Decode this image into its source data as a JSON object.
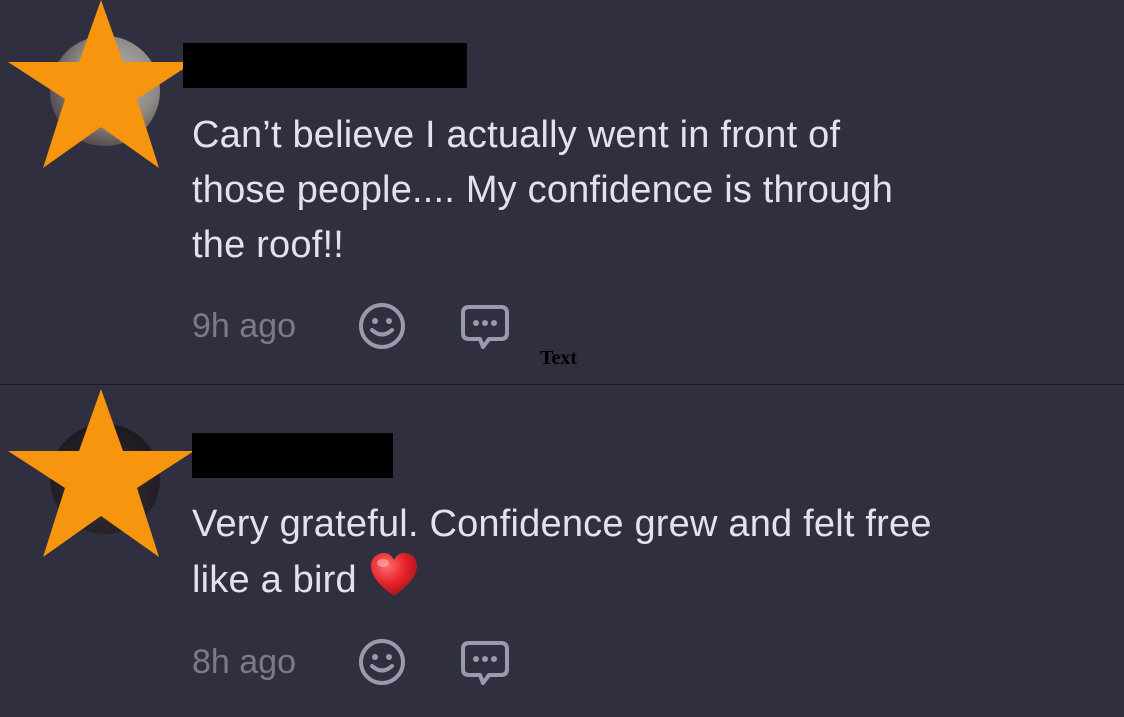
{
  "comments": [
    {
      "author_redacted": true,
      "text": "Can’t believe I actually went in front of\nthose people.... My confidence is through\nthe roof!!",
      "time": "9h ago",
      "icons": {
        "react": "smiley-face-icon",
        "reply": "speech-bubble-icon"
      }
    },
    {
      "author_redacted": true,
      "text": "Very grateful. Confidence grew and felt free\nlike a bird",
      "emoji": "red-heart-icon",
      "time": "8h ago",
      "icons": {
        "react": "smiley-face-icon",
        "reply": "speech-bubble-icon"
      }
    }
  ],
  "overlay_label": "Text",
  "colors": {
    "background": "#2f2f40",
    "text": "#e2e1ee",
    "muted": "#7a7a8b",
    "star": "#f7950f",
    "divider": "#1b1b25"
  }
}
